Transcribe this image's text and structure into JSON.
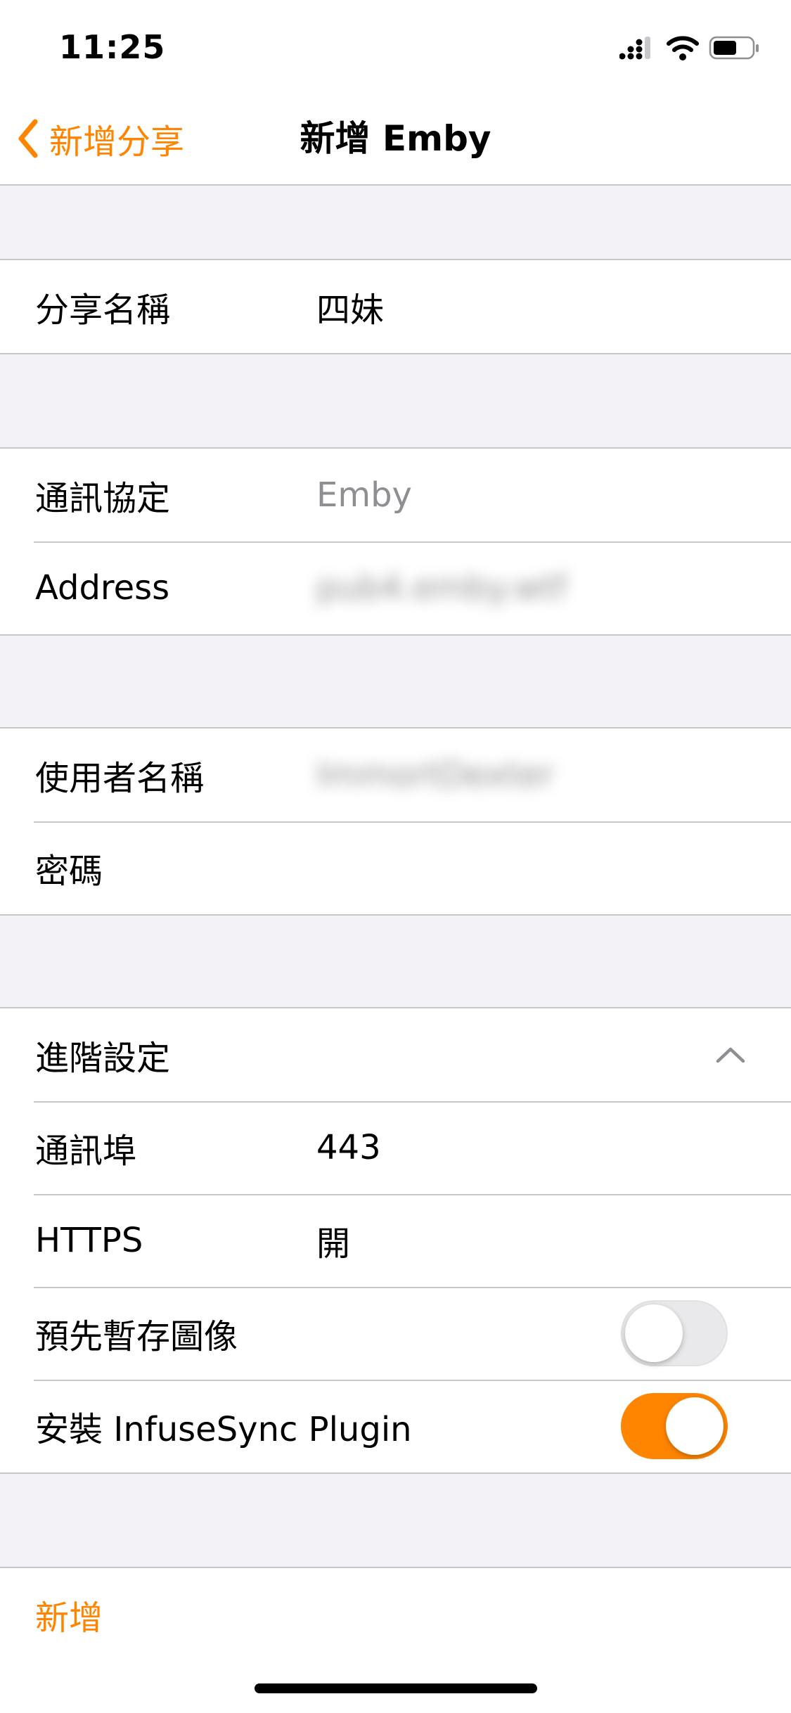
{
  "status_bar": {
    "time": "11:25"
  },
  "nav": {
    "back_label": "新增分享",
    "title": "新增 Emby"
  },
  "share_section": {
    "name_label": "分享名稱",
    "name_value": "四妹"
  },
  "connection_section": {
    "protocol_label": "通訊協定",
    "protocol_value": "Emby",
    "address_label": "Address",
    "address_value": "pub4.emby.wtf"
  },
  "auth_section": {
    "username_label": "使用者名稱",
    "username_value": "ImmortDexter",
    "password_label": "密碼"
  },
  "advanced_section": {
    "header_label": "進階設定",
    "port_label": "通訊埠",
    "port_value": "443",
    "https_label": "HTTPS",
    "https_value": "開",
    "cache_images_label": "預先暫存圖像",
    "cache_images_on": false,
    "plugin_label": "安裝 InfuseSync Plugin",
    "plugin_on": true
  },
  "actions": {
    "add_label": "新增"
  },
  "colors": {
    "accent": "#ff8500",
    "background": "#f2f2f7",
    "separator": "#c8c7cc",
    "muted_text": "#8e8e93"
  },
  "icons": {
    "back": "chevron-left-icon",
    "expand": "chevron-up-icon",
    "signal": "cellular-signal-icon",
    "wifi": "wifi-icon",
    "battery": "battery-icon"
  }
}
